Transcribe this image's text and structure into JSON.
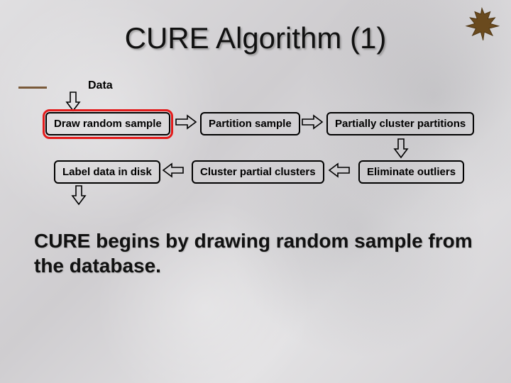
{
  "title": "CURE Algorithm (1)",
  "flow": {
    "data_label": "Data",
    "box_draw": "Draw random sample",
    "box_partition": "Partition sample",
    "box_partial": "Partially cluster partitions",
    "box_label": "Label data in disk",
    "box_cluster": "Cluster partial clusters",
    "box_elim": "Eliminate outliers"
  },
  "body": "CURE begins by drawing random sample from the database.",
  "icons": {
    "corner": "maple-leaf-icon"
  }
}
